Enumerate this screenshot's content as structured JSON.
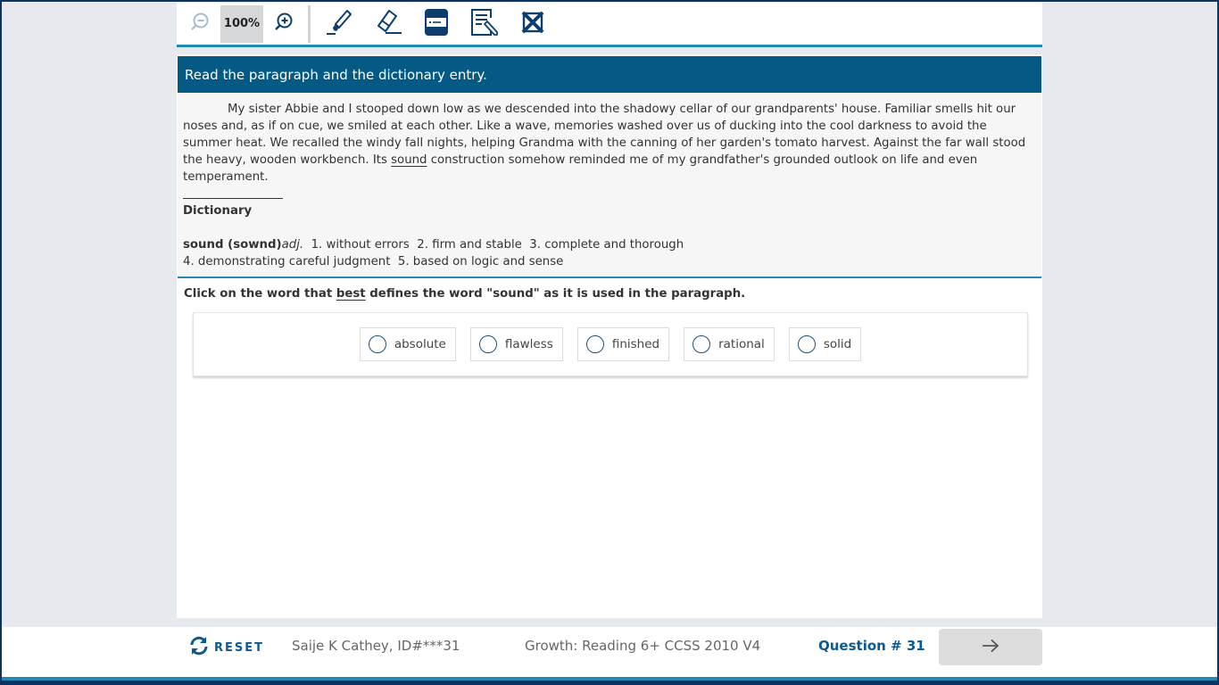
{
  "toolbar": {
    "zoom_level": "100%",
    "icons": {
      "zoom_out": "zoom-out-icon",
      "zoom_in": "zoom-in-icon",
      "highlighter": "highlighter-icon",
      "eraser": "eraser-icon",
      "line_reader": "line-reader-icon",
      "notepad": "notepad-icon",
      "answer_eliminator": "answer-eliminator-icon"
    }
  },
  "stem": {
    "header": "Read the paragraph and the dictionary entry.",
    "paragraph": {
      "before": "My sister Abbie and I stooped down low as we descended into the shadowy cellar of our grandparents' house. Familiar smells hit our noses and, as if on cue, we smiled at each other. Like a wave, memories washed over us of ducking into the cool darkness to avoid the summer heat. We recalled the windy fall nights, helping Grandma with the canning of her garden's tomato harvest. Against the far wall stood the heavy, wooden workbench. Its ",
      "underlined": "sound",
      "after": " construction somehow reminded me of my grandfather's grounded outlook on life and even temperament."
    },
    "dictionary": {
      "title": "Dictionary",
      "headword": "sound (sownd)",
      "pos": "adj.",
      "line1": "  1. without errors  2. firm and stable  3. complete and thorough",
      "line2": "4. demonstrating careful judgment  5. based on logic and sense"
    }
  },
  "question": {
    "prompt_before": "Click on the word that ",
    "prompt_underlined": "best",
    "prompt_after": " defines the word \"sound\" as it is used in the paragraph.",
    "options": [
      {
        "label": "absolute",
        "selected": false
      },
      {
        "label": "flawless",
        "selected": false
      },
      {
        "label": "finished",
        "selected": false
      },
      {
        "label": "rational",
        "selected": false
      },
      {
        "label": "solid",
        "selected": false
      }
    ]
  },
  "footer": {
    "reset_label": "RESET",
    "student": "Saije K Cathey, ID#***31",
    "test_name": "Growth: Reading 6+ CCSS 2010 V4",
    "question_number": "Question # 31",
    "next_icon": "arrow-right-icon"
  },
  "colors": {
    "primary": "#045a84",
    "accent": "#2189b6",
    "frame": "#0b3560",
    "link": "#0b5a93"
  }
}
